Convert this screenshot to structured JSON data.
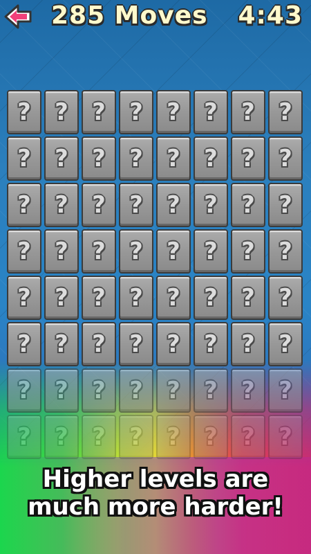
{
  "header": {
    "back_icon": "left-arrow-icon",
    "moves": "285 Moves",
    "timer": "4:43"
  },
  "board": {
    "rows": 8,
    "cols": 8,
    "card_symbol": "?",
    "card_state": "face-down"
  },
  "caption": {
    "line1": "Higher levels are",
    "line2": "much more harder!"
  },
  "colors": {
    "text_yellow": "#fff9cc",
    "card_gray": "#989898",
    "back_arrow": "#f0407a"
  }
}
